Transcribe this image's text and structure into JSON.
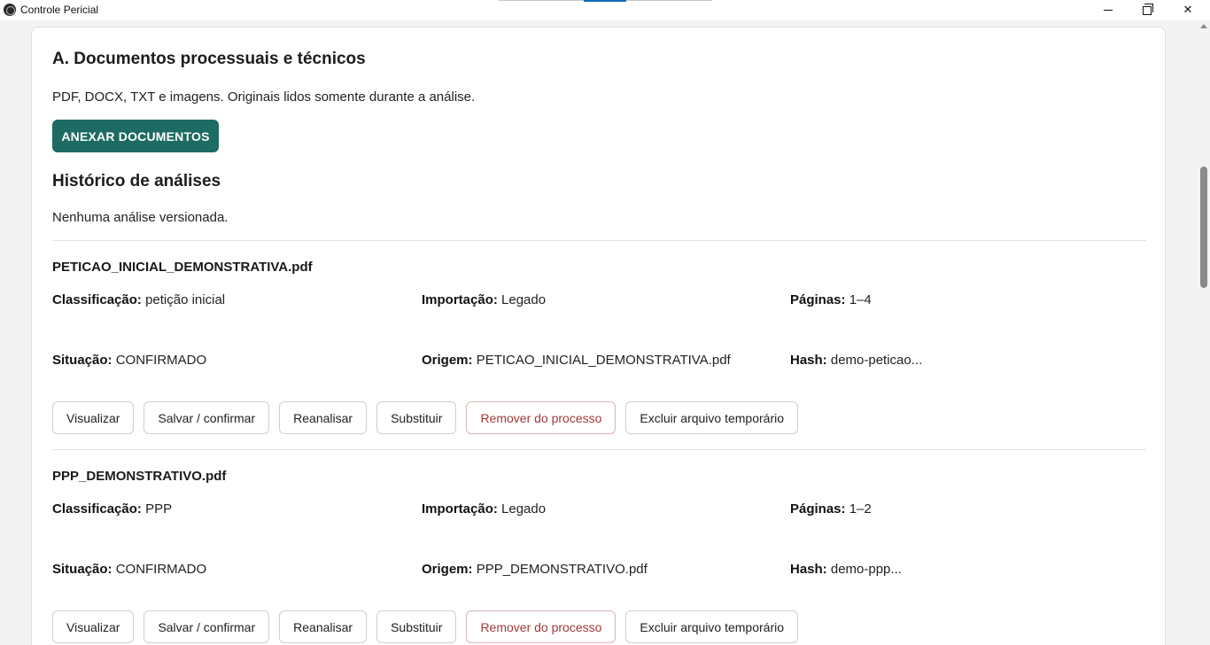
{
  "window": {
    "title": "Controle Pericial",
    "minimize_icon": "minimize-icon",
    "maximize_icon": "restore-icon",
    "close_icon": "close-icon",
    "close_glyph": "✕"
  },
  "section": {
    "title": "A. Documentos processuais e técnicos",
    "description": "PDF, DOCX, TXT e imagens. Originais lidos somente durante a análise.",
    "attach_button": "ANEXAR DOCUMENTOS"
  },
  "history": {
    "title": "Histórico de análises",
    "empty_message": "Nenhuma análise versionada."
  },
  "labels": {
    "classification": "Classificação:",
    "import": "Importação:",
    "pages": "Páginas:",
    "status": "Situação:",
    "origin": "Origem:",
    "hash": "Hash:"
  },
  "actions": {
    "view": "Visualizar",
    "save": "Salvar / confirmar",
    "reanalyze": "Reanalisar",
    "replace": "Substituir",
    "remove": "Remover do processo",
    "delete_temp": "Excluir arquivo temporário"
  },
  "documents": [
    {
      "name": "PETICAO_INICIAL_DEMONSTRATIVA.pdf",
      "classification": "petição inicial",
      "import": "Legado",
      "pages": "1–4",
      "status": "CONFIRMADO",
      "origin": "PETICAO_INICIAL_DEMONSTRATIVA.pdf",
      "hash": "demo-peticao..."
    },
    {
      "name": "PPP_DEMONSTRATIVO.pdf",
      "classification": "PPP",
      "import": "Legado",
      "pages": "1–2",
      "status": "CONFIRMADO",
      "origin": "PPP_DEMONSTRATIVO.pdf",
      "hash": "demo-ppp..."
    }
  ],
  "colors": {
    "primary": "#1d6b63",
    "danger": "#a23a3a",
    "tab_active": "#0f6cbd"
  }
}
